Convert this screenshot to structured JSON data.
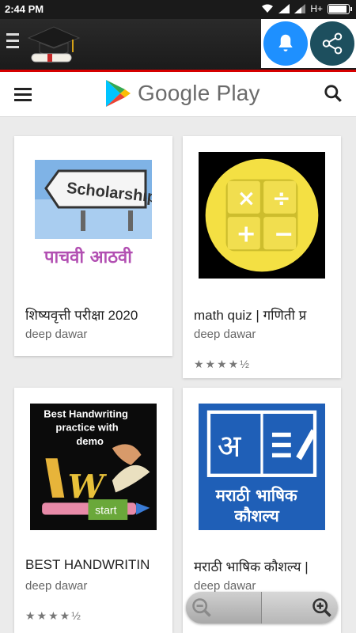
{
  "status_bar": {
    "time": "2:44 PM",
    "network": "H+"
  },
  "app_bar": {
    "menu_icon": "hamburger-icon",
    "logo_icon": "graduation-cap-icon",
    "notification_icon": "bell-icon",
    "share_icon": "share-icon"
  },
  "play_header": {
    "brand": "Google Play",
    "menu_icon": "hamburger-icon",
    "search_icon": "search-icon"
  },
  "apps": [
    {
      "title": "शिष्यवृत्ती परीक्षा 2020",
      "developer": "deep dawar",
      "thumb_sign": "Scholarship",
      "thumb_text": "पाचवी आठवी",
      "rating": ""
    },
    {
      "title": "math quiz | गणिती प्र",
      "developer": "deep dawar",
      "rating": "★★★★½"
    },
    {
      "title": "BEST HANDWRITIN",
      "developer": "deep dawar",
      "thumb_line1": "Best Handwriting",
      "thumb_line2": "practice with",
      "thumb_line3": "demo",
      "thumb_btn": "start",
      "rating": "★★★★½"
    },
    {
      "title": "मराठी भाषिक कौशल्य |",
      "developer": "deep dawar",
      "thumb_letter": "अ",
      "thumb_line1": "मराठी भाषिक",
      "thumb_line2": "कौशल्य",
      "rating": ""
    }
  ],
  "zoom_control": {
    "out_icon": "zoom-out-icon",
    "in_icon": "zoom-in-icon"
  },
  "colors": {
    "appbar_red": "#d60000",
    "bell_blue": "#1e90ff",
    "share_teal": "#1d4f5e"
  }
}
